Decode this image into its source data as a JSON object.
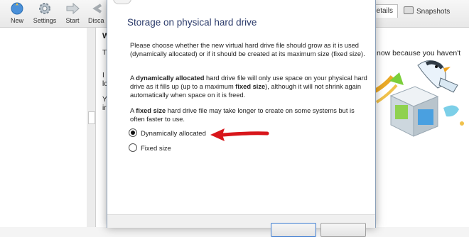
{
  "toolbar": {
    "items": [
      {
        "label": "New",
        "icon": "new-icon"
      },
      {
        "label": "Settings",
        "icon": "gear-icon"
      },
      {
        "label": "Start",
        "icon": "start-arrow-icon"
      },
      {
        "label": "Disca",
        "icon": "discard-icon"
      }
    ],
    "tabs": {
      "details": "etails",
      "snapshots": "Snapshots"
    }
  },
  "background": {
    "welcome_fragment": "W",
    "left_fragments": [
      "T",
      "I",
      "lo",
      "Y",
      "ir"
    ],
    "right_fragment": "now because you haven't"
  },
  "dialog": {
    "title": "Storage on physical hard drive",
    "paragraph1": "Please choose whether the new virtual hard drive file should grow as it is used (dynamically allocated) or if it should be created at its maximum size (fixed size).",
    "paragraph2": {
      "pre": "A ",
      "bold": "dynamically allocated",
      "mid": " hard drive file will only use space on your physical hard drive as it fills up (up to a maximum ",
      "bold2": "fixed size",
      "post": "), although it will not shrink again automatically when space on it is freed."
    },
    "paragraph3": {
      "pre": "A ",
      "bold": "fixed size",
      "post": " hard drive file may take longer to create on some systems but is often faster to use."
    },
    "options": [
      {
        "label": "Dynamically allocated",
        "selected": true
      },
      {
        "label": "Fixed size",
        "selected": false
      }
    ]
  },
  "colors": {
    "title": "#2a3a6a",
    "accent": "#3b7bd1",
    "annotation_arrow": "#d8161b"
  }
}
